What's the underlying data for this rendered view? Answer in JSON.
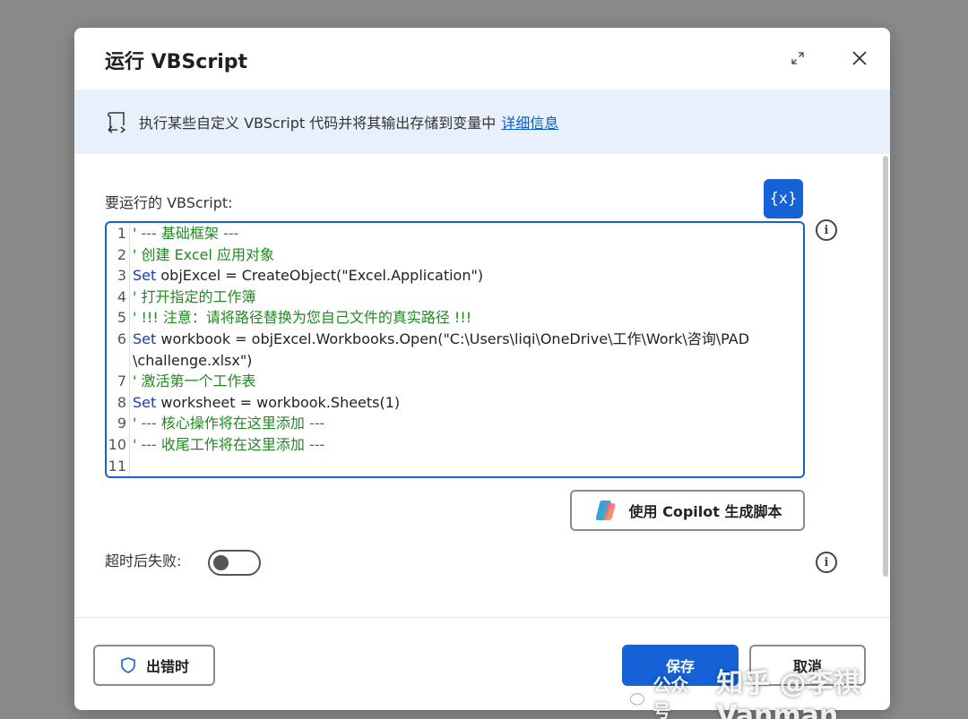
{
  "dialog": {
    "title": "运行 VBScript"
  },
  "info_bar": {
    "text": "执行某些自定义 VBScript 代码并将其输出存储到变量中",
    "link": "详细信息"
  },
  "script_field": {
    "label": "要运行的 VBScript:",
    "variable_button": "{x}",
    "lines": [
      {
        "n": "1",
        "parts": [
          {
            "t": "' --- 基础框架 ---",
            "k": "comment"
          }
        ]
      },
      {
        "n": "2",
        "parts": [
          {
            "t": "' 创建 Excel 应用对象",
            "k": "comment"
          }
        ]
      },
      {
        "n": "3",
        "parts": [
          {
            "t": "Set",
            "k": "kw"
          },
          {
            "t": " objExcel = CreateObject(\"Excel.Application\")",
            "k": "normal"
          }
        ]
      },
      {
        "n": "4",
        "parts": [
          {
            "t": "' 打开指定的工作簿",
            "k": "comment"
          }
        ]
      },
      {
        "n": "5",
        "parts": [
          {
            "t": "' !!! 注意：请将路径替换为您自己文件的真实路径 !!!",
            "k": "comment"
          }
        ]
      },
      {
        "n": "6",
        "parts": [
          {
            "t": "Set",
            "k": "kw"
          },
          {
            "t": " workbook = objExcel.Workbooks.Open(\"C:\\Users\\liqi\\OneDrive\\工作\\Work\\咨询\\PAD",
            "k": "normal"
          }
        ]
      },
      {
        "n": "",
        "parts": [
          {
            "t": "\\challenge.xlsx\")",
            "k": "normal"
          }
        ]
      },
      {
        "n": "7",
        "parts": [
          {
            "t": "' 激活第一个工作表",
            "k": "comment"
          }
        ]
      },
      {
        "n": "8",
        "parts": [
          {
            "t": "Set",
            "k": "kw"
          },
          {
            "t": " worksheet = workbook.Sheets(1)",
            "k": "normal"
          }
        ]
      },
      {
        "n": "9",
        "parts": [
          {
            "t": "' --- 核心操作将在这里添加 ---",
            "k": "comment"
          }
        ]
      },
      {
        "n": "10",
        "parts": [
          {
            "t": "' --- 收尾工作将在这里添加 ---",
            "k": "comment"
          }
        ]
      },
      {
        "n": "11",
        "parts": [
          {
            "t": "",
            "k": "normal"
          }
        ]
      }
    ]
  },
  "copilot_button": "使用 Copilot 生成脚本",
  "timeout": {
    "label": "超时后失败:",
    "enabled": false
  },
  "footer": {
    "on_error": "出错时",
    "save": "保存",
    "cancel": "取消"
  },
  "watermark": {
    "wechat": "公众号",
    "text": "知乎 @李祺Vanman"
  },
  "colors": {
    "accent": "#1462d6",
    "comment": "#1f8a1f",
    "keyword": "#1b3db1",
    "info_bg": "#e8f1fb"
  }
}
